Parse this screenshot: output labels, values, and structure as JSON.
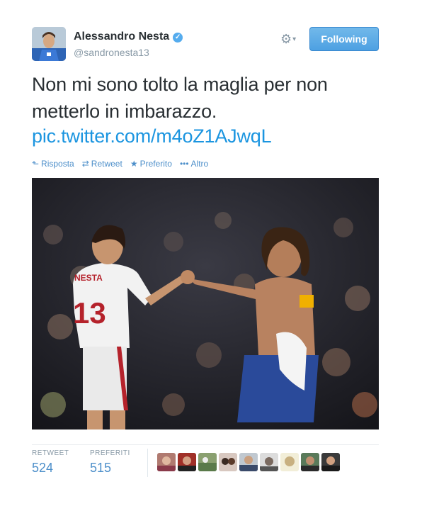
{
  "author": {
    "name": "Alessandro Nesta",
    "handle": "@sandronesta13",
    "verified_icon": "verified-badge-icon"
  },
  "header": {
    "follow_label": "Following",
    "gear_icon": "gear-icon",
    "accent": "#55acee"
  },
  "tweet": {
    "text": "Non mi sono tolto la maglia per non metterlo in imbarazzo.",
    "link": "pic.twitter.com/m4oZ1AJwqL"
  },
  "actions": [
    {
      "icon": "reply-icon",
      "label": "Risposta"
    },
    {
      "icon": "retweet-icon",
      "label": "Retweet"
    },
    {
      "icon": "star-icon",
      "label": "Preferito"
    },
    {
      "icon": "more-icon",
      "label": "Altro"
    }
  ],
  "stats": {
    "retweets_label": "RETWEET",
    "retweets_count": "524",
    "favorites_label": "PREFERITI",
    "favorites_count": "515"
  },
  "colors": {
    "link": "#1b95e0",
    "action": "#4d8fca",
    "muted": "#8899a6",
    "text": "#292f33"
  }
}
